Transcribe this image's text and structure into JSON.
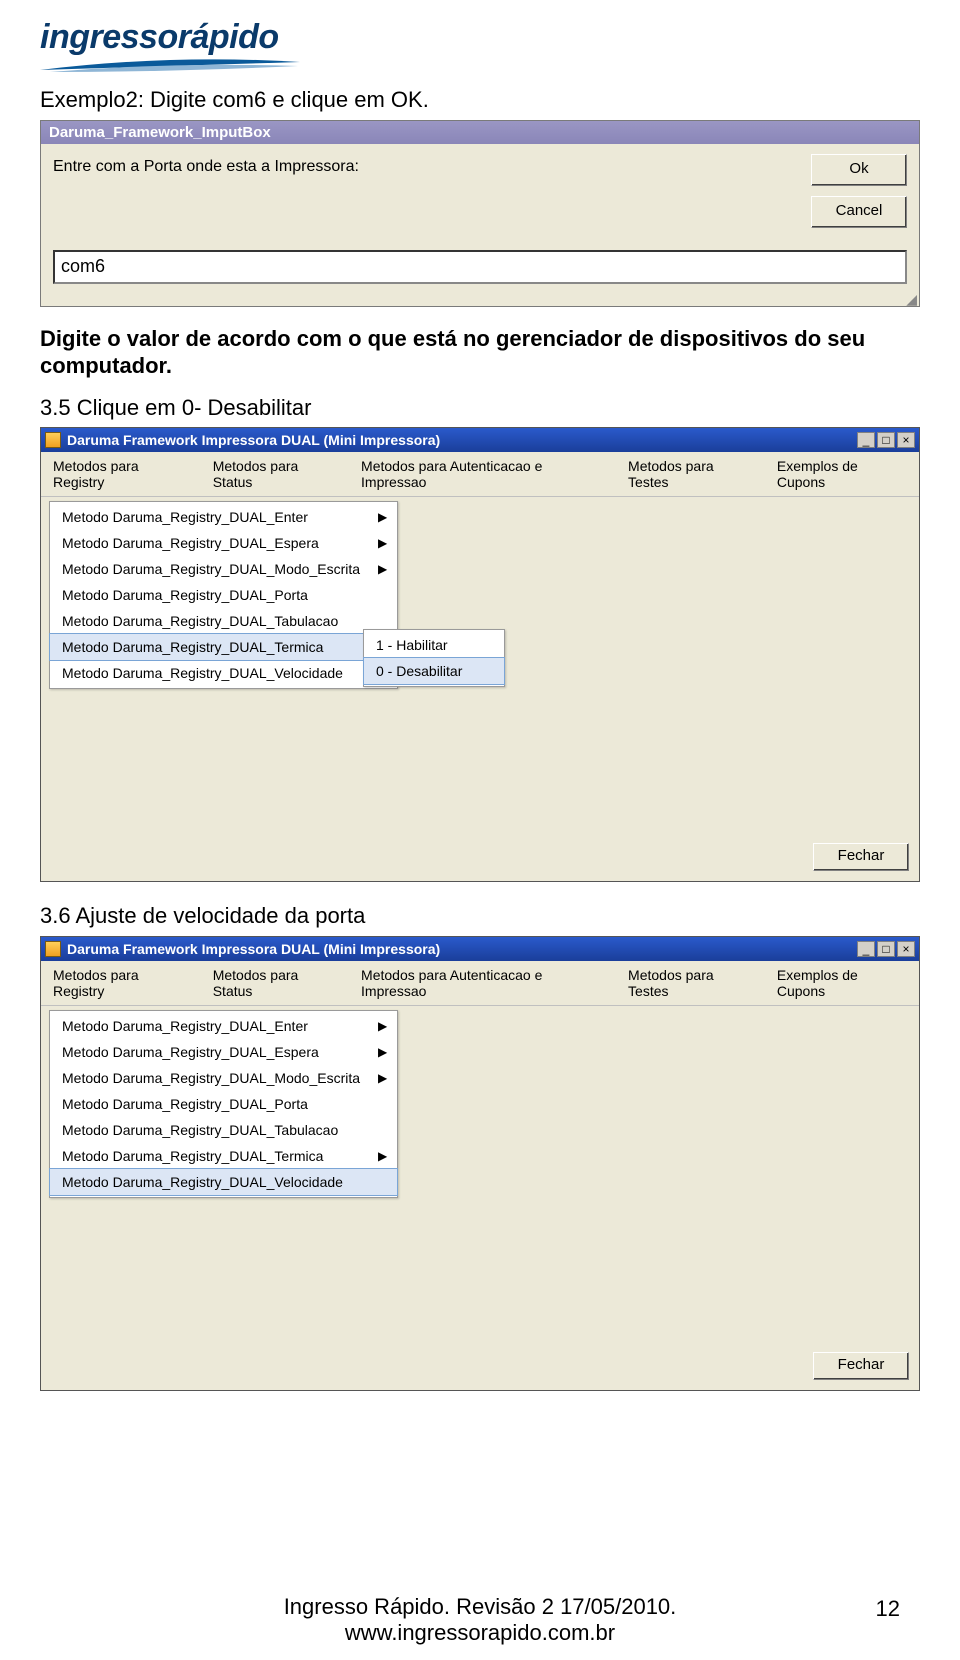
{
  "logo": {
    "text": "ingressorápido"
  },
  "text": {
    "ex2": "Exemplo2: Digite com6 e clique em OK.",
    "digite": "Digite o valor de acordo com o que está no gerenciador de dispositivos do seu computador.",
    "s35": "3.5 Clique em 0- Desabilitar",
    "s36": "3.6 Ajuste de velocidade da porta"
  },
  "dlg1": {
    "title": "Daruma_Framework_ImputBox",
    "prompt": "Entre com a Porta onde esta a Impressora:",
    "ok": "Ok",
    "cancel": "Cancel",
    "value": "com6"
  },
  "fw": {
    "title": "Daruma Framework Impressora DUAL (Mini Impressora)",
    "menus": [
      "Metodos para Registry",
      "Metodos para Status",
      "Metodos para Autenticacao e Impressao",
      "Metodos para Testes",
      "Exemplos de Cupons"
    ],
    "items": [
      {
        "label": "Metodo Daruma_Registry_DUAL_Enter",
        "arrow": true
      },
      {
        "label": "Metodo Daruma_Registry_DUAL_Espera",
        "arrow": true
      },
      {
        "label": "Metodo Daruma_Registry_DUAL_Modo_Escrita",
        "arrow": true
      },
      {
        "label": "Metodo Daruma_Registry_DUAL_Porta",
        "arrow": false
      },
      {
        "label": "Metodo Daruma_Registry_DUAL_Tabulacao",
        "arrow": false
      },
      {
        "label": "Metodo Daruma_Registry_DUAL_Termica",
        "arrow": true
      },
      {
        "label": "Metodo Daruma_Registry_DUAL_Velocidade",
        "arrow": false
      }
    ],
    "sub35_selected_index": 5,
    "sub35_sub": [
      {
        "label": "1 - Habilitar",
        "sel": false
      },
      {
        "label": "0 - Desabilitar",
        "sel": true
      }
    ],
    "sub36_selected_index": 6,
    "fechar": "Fechar"
  },
  "footer": {
    "line1": "Ingresso Rápido. Revisão 2 17/05/2010.",
    "line2": "www.ingressorapido.com.br",
    "page": "12"
  }
}
